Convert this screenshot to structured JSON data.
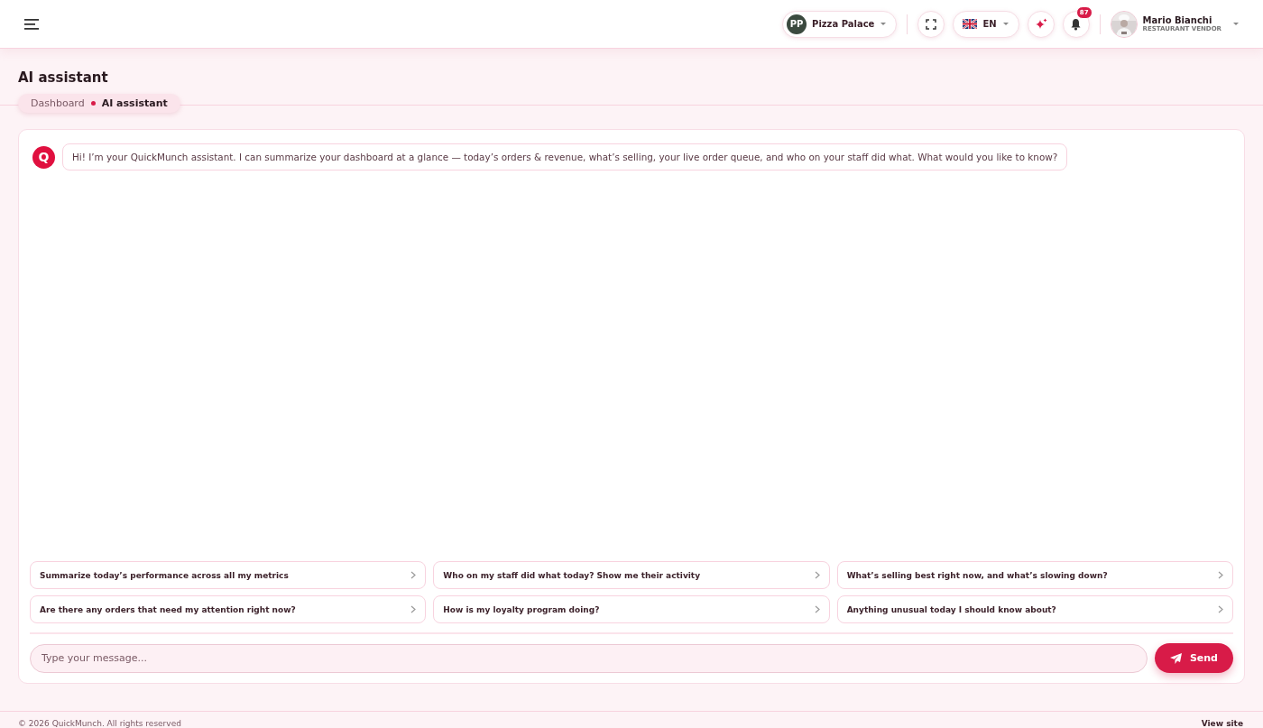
{
  "header": {
    "restaurant": {
      "initials": "PP",
      "name": "Pizza Palace"
    },
    "language": "EN",
    "notifications": "87",
    "user": {
      "name": "Mario Bianchi",
      "role": "RESTAURANT VENDOR"
    }
  },
  "page": {
    "title": "AI assistant",
    "breadcrumb": [
      {
        "label": "Dashboard",
        "selected": false
      },
      {
        "label": "AI assistant",
        "selected": true
      }
    ]
  },
  "chat": {
    "messages": [
      {
        "avatar": "Q",
        "text": "Hi! I’m your QuickMunch assistant. I can summarize your dashboard at a glance — today’s orders & revenue, what’s selling, your live order queue, and who on your staff did what. What would you like to know?"
      }
    ],
    "suggestions": [
      "Summarize today’s performance across all my metrics",
      "Who on my staff did what today? Show me their activity",
      "What’s selling best right now, and what’s slowing down?",
      "Are there any orders that need my attention right now?",
      "How is my loyalty program doing?",
      "Anything unusual today I should know about?"
    ],
    "input": {
      "placeholder": "Type your message..."
    },
    "send": "Send"
  },
  "footer": {
    "copyright": "© 2026 QuickMunch. All rights reserved",
    "link": "View site"
  }
}
